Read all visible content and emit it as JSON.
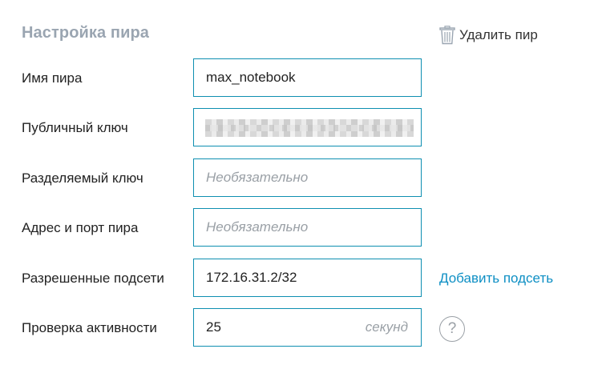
{
  "header": {
    "title": "Настройка пира",
    "delete_label": "Удалить пир"
  },
  "form": {
    "peer_name": {
      "label": "Имя пира",
      "value": "max_notebook"
    },
    "public_key": {
      "label": "Публичный ключ"
    },
    "preshared_key": {
      "label": "Разделяемый ключ",
      "placeholder": "Необязательно"
    },
    "endpoint": {
      "label": "Адрес и порт пира",
      "placeholder": "Необязательно"
    },
    "allowed_ips": {
      "label": "Разрешенные подсети",
      "value": "172.16.31.2/32",
      "add_label": "Добавить подсеть"
    },
    "keepalive": {
      "label": "Проверка активности",
      "value": "25",
      "unit": "секунд",
      "help_icon": "?"
    }
  },
  "colors": {
    "accent": "#0e8fb1",
    "link": "#0e8fc4",
    "title": "#9aa5b1",
    "placeholder": "#9aa0a6"
  },
  "icons": {
    "delete": "trash-icon",
    "help": "question-circle-icon"
  }
}
